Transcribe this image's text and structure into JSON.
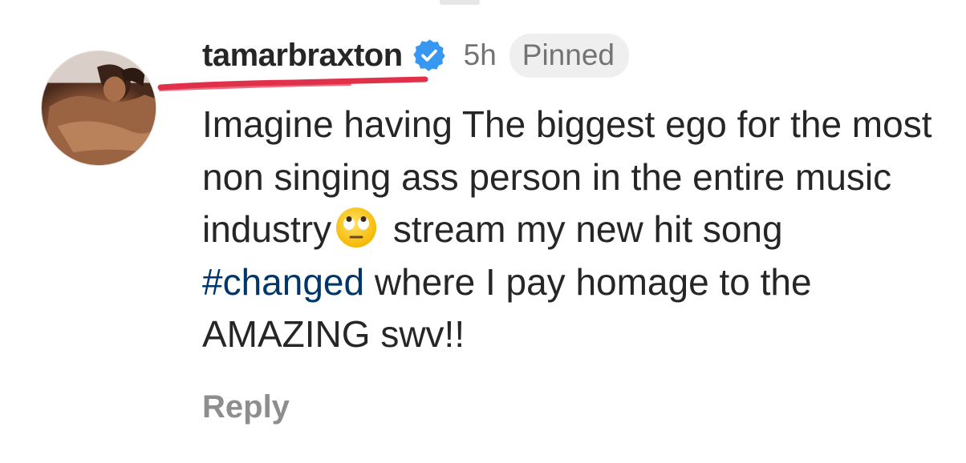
{
  "comment": {
    "username": "tamarbraxton",
    "verified": true,
    "verified_icon": "verified-badge-icon",
    "time": "5h",
    "pinned_label": "Pinned",
    "text_part1": "Imagine having The biggest ego for the most non singing ass person in the entire music industry",
    "emoji_icon": "face-with-rolling-eyes-icon",
    "text_part2": " stream my new hit song ",
    "hashtag": "#changed",
    "text_part3": " where I pay homage to the AMAZING swv!!",
    "reply_label": "Reply"
  },
  "colors": {
    "verified_badge": "#3897f0",
    "hashtag": "#00376b",
    "underline_annotation": "#e0304a",
    "meta_text": "#737373",
    "pinned_bg": "#efefef",
    "reply_text": "#8e8e8e"
  }
}
